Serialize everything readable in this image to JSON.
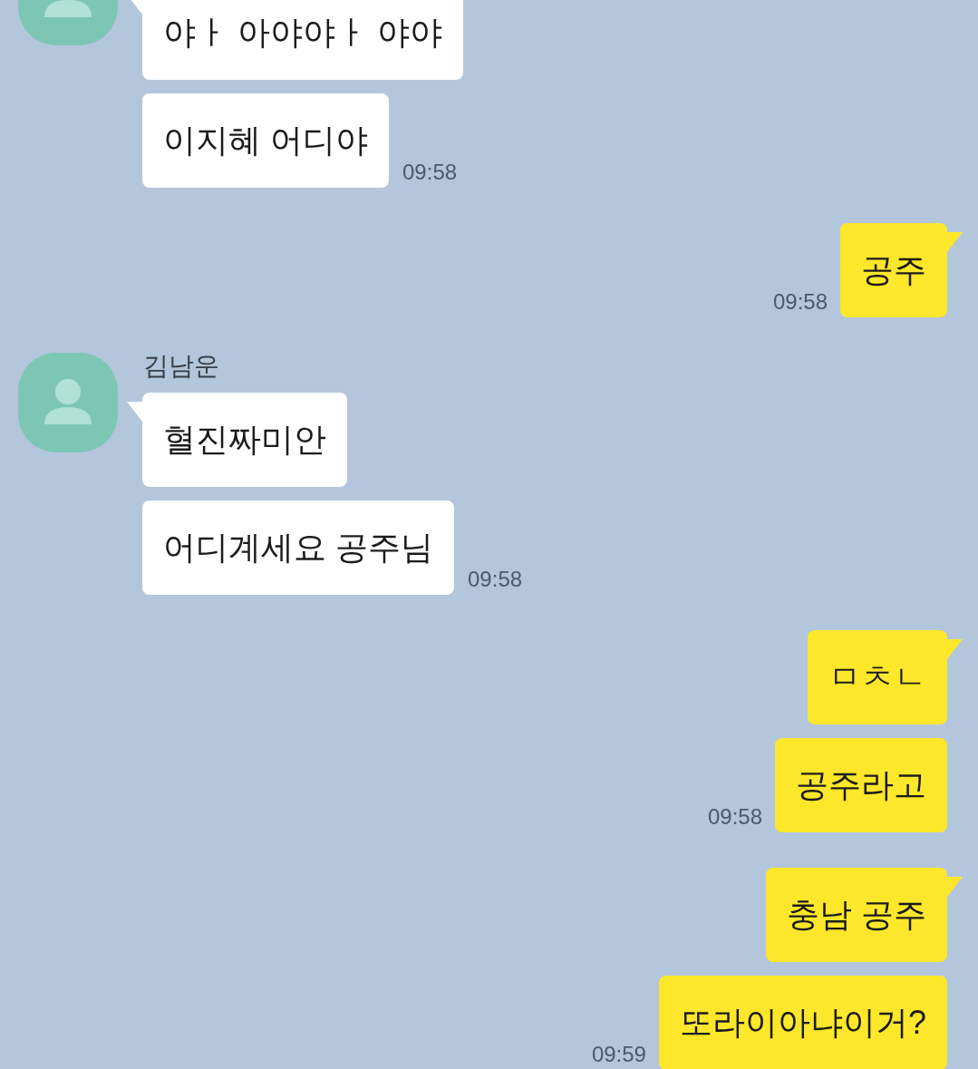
{
  "chat": {
    "groups": [
      {
        "kind": "received",
        "messages": [
          "야ㅏ 아야야ㅏ 야야",
          "이지혜 어디야"
        ],
        "time": "09:58"
      },
      {
        "kind": "sent",
        "messages": [
          "공주"
        ],
        "time": "09:58"
      },
      {
        "kind": "received",
        "sender": "김남운",
        "messages": [
          "혈진짜미안",
          "어디계세요 공주님"
        ],
        "time": "09:58"
      },
      {
        "kind": "sent",
        "messages": [
          "ㅁㅊㄴ",
          "공주라고"
        ],
        "time": "09:58"
      },
      {
        "kind": "sent",
        "messages": [
          "충남 공주",
          "또라이아냐이거?"
        ],
        "time": "09:59"
      }
    ]
  }
}
